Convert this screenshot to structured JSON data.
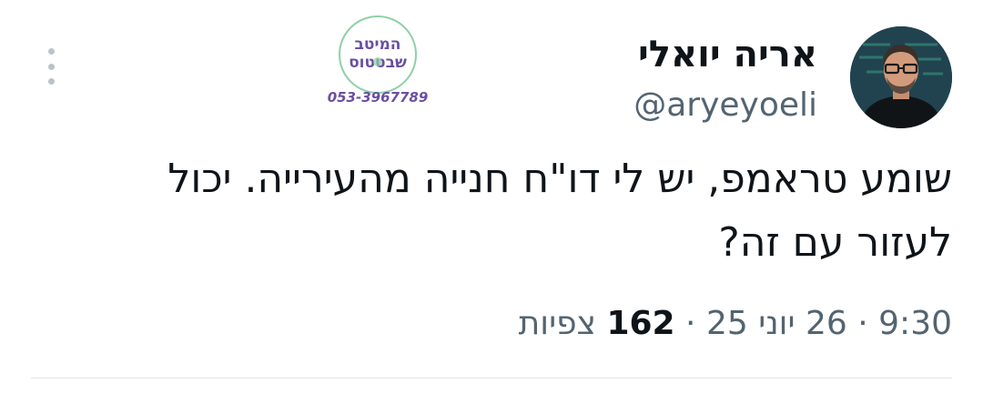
{
  "author": {
    "name": "אריה יואלי",
    "handle": "@aryeyoeli"
  },
  "watermark": {
    "brand_line1": "המיטב",
    "brand_line2": "שבטטוס",
    "phone": "053-3967789",
    "accent_color": "#6a4fa3",
    "ring_color": "#8fd0a6"
  },
  "tweet": {
    "text_line1": "שומע טראמפ, יש לי דו\"ח חנייה מהעירייה. יכול",
    "text_line2": "לעזור עם זה?"
  },
  "meta": {
    "time": "9:30",
    "date": "26 יוני 25",
    "views_count": "162",
    "views_label": "צפיות",
    "separator": "·"
  },
  "icons": {
    "more": "more-vertical-icon"
  },
  "colors": {
    "text_primary": "#0f1419",
    "text_secondary": "#536471",
    "divider": "#dfe4e8"
  }
}
